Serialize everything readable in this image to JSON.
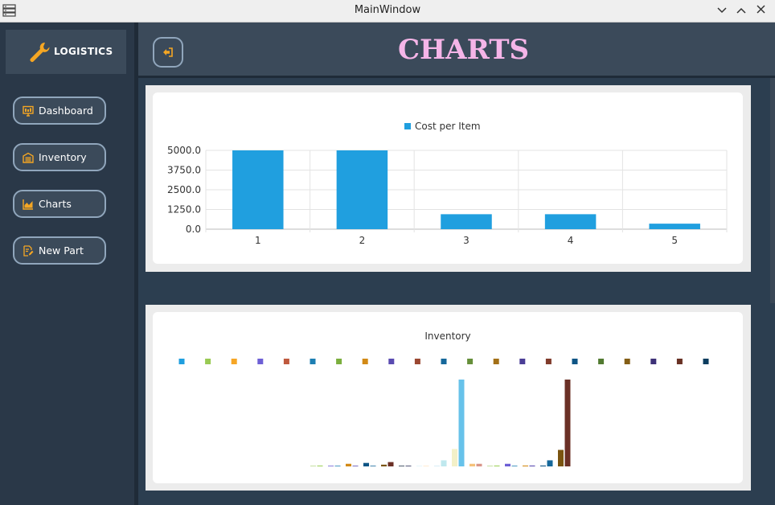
{
  "window": {
    "title": "MainWindow",
    "controls": [
      "chevron-down",
      "chevron-up",
      "close"
    ]
  },
  "sidebar": {
    "logo_label": "LOGISTICS",
    "items": [
      {
        "label": "Dashboard",
        "icon": "monitor-icon"
      },
      {
        "label": "Inventory",
        "icon": "warehouse-icon"
      },
      {
        "label": "Charts",
        "icon": "area-chart-icon"
      },
      {
        "label": "New Part",
        "icon": "edit-document-icon"
      }
    ]
  },
  "header": {
    "title": "CHARTS",
    "back_icon": "sign-out-icon"
  },
  "colors": {
    "accent": "#f5a623",
    "title_pink": "#f5b5e8",
    "bg_dark": "#2c3e50",
    "bar_blue": "#209fdf"
  },
  "chart_data": [
    {
      "type": "bar",
      "title": "",
      "legend": "Cost per Item",
      "legend_position": "top",
      "categories": [
        "1",
        "2",
        "3",
        "4",
        "5"
      ],
      "series": [
        {
          "name": "Cost per Item",
          "values": [
            5000,
            5000,
            950,
            950,
            350
          ]
        }
      ],
      "yticks": [
        "5000.0",
        "3750.0",
        "2500.0",
        "1250.0",
        "0.0"
      ],
      "ylim": [
        0,
        5000
      ],
      "grid": true
    },
    {
      "type": "bar",
      "title": "Inventory",
      "legend_position": "top",
      "legend_colors": [
        "#209fdf",
        "#99ca53",
        "#f6a625",
        "#6d5fd5",
        "#bf593e",
        "#1d7fb3",
        "#7baf3e",
        "#d28a16",
        "#5a4bb1",
        "#9b4832",
        "#16689b",
        "#668f3a",
        "#a37017",
        "#4b3e96",
        "#803b2b",
        "#0e5585",
        "#527a31",
        "#845e16",
        "#3e3278",
        "#683124",
        "#0c3d5f"
      ],
      "series": [
        {
          "values": [
            0,
            1
          ]
        },
        {
          "values": [
            0,
            0
          ]
        },
        {
          "values": [
            3,
            0
          ]
        },
        {
          "values": [
            4,
            0
          ]
        },
        {
          "values": [
            2,
            5
          ]
        },
        {
          "values": [
            0,
            0
          ]
        },
        {
          "values": [
            0,
            0
          ]
        },
        {
          "values": [
            0,
            7
          ]
        },
        {
          "values": [
            20,
            100
          ]
        },
        {
          "values": [
            3,
            3
          ]
        },
        {
          "values": [
            0,
            1
          ]
        },
        {
          "values": [
            3,
            0
          ]
        },
        {
          "values": [
            1,
            1
          ]
        },
        {
          "values": [
            1,
            7
          ]
        },
        {
          "values": [
            19,
            100
          ]
        }
      ],
      "ylim": [
        0,
        100
      ],
      "grid": false
    }
  ]
}
